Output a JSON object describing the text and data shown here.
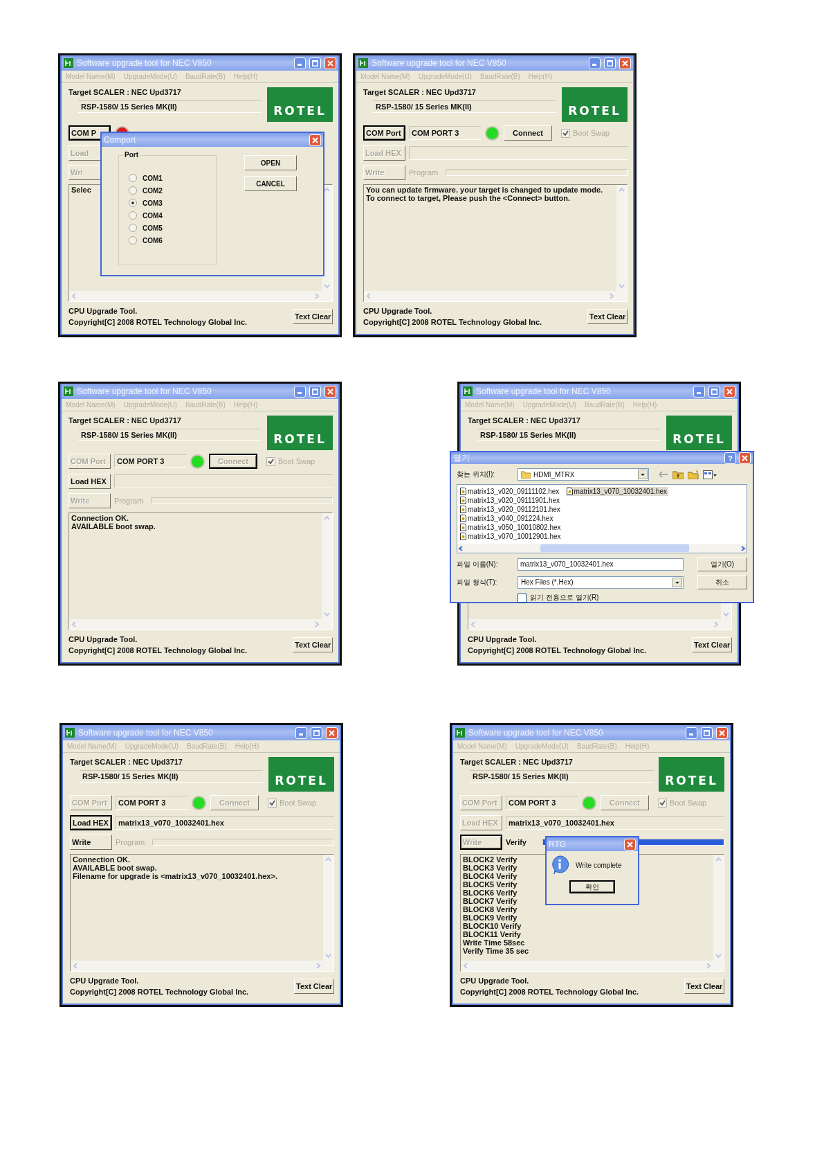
{
  "windows": [
    {
      "title": "Software upgrade tool for NEC V850",
      "menu": [
        "Model Name(M)",
        "UpgradeMode(U)",
        "BaudRate(B)",
        "Help(H)"
      ],
      "target": "Target SCALER : NEC Upd3717",
      "model": "RSP-1580/ 15 Series MK(II)",
      "logo": "ROTEL",
      "com_port": {
        "label": "COM P",
        "disabled": false,
        "focused": true
      },
      "led": {
        "color": "#e01818"
      },
      "load_hex": {
        "label": "Load",
        "disabled": true,
        "focused": false
      },
      "write": {
        "label": "Wri",
        "disabled": true,
        "focused": false
      },
      "log": [
        "Selec"
      ],
      "footer": [
        "CPU Upgrade Tool.",
        "Copyright[C] 2008 ROTEL Technology Global Inc."
      ],
      "text_clear": {
        "label": "Text Clear",
        "disabled": false,
        "focused": false
      },
      "dialog": {
        "kind": "comport",
        "title": "Comport",
        "group": "Port",
        "options": [
          {
            "label": "COM1",
            "selected": false
          },
          {
            "label": "COM2",
            "selected": false
          },
          {
            "label": "COM3",
            "selected": true
          },
          {
            "label": "COM4",
            "selected": false
          },
          {
            "label": "COM5",
            "selected": false
          },
          {
            "label": "COM6",
            "selected": false
          }
        ],
        "buttons": [
          "OPEN",
          "CANCEL"
        ]
      }
    },
    {
      "title": "Software upgrade tool for NEC V850",
      "menu": [
        "Model Name(M)",
        "UpgradeMode(U)",
        "BaudRate(B)",
        "Help(H)"
      ],
      "target": "Target SCALER : NEC Upd3717",
      "model": "RSP-1580/ 15 Series MK(II)",
      "logo": "ROTEL",
      "com_port": {
        "label": "COM Port",
        "disabled": false,
        "focused": true
      },
      "port": "COM PORT 3",
      "led": {
        "color": "#22dd22"
      },
      "connect": {
        "label": "Connect",
        "disabled": false,
        "focused": false
      },
      "boot_swap": {
        "label": "Boot Swap",
        "checked": true,
        "disabled": true
      },
      "load_hex": {
        "label": "Load HEX",
        "disabled": true,
        "focused": false
      },
      "write": {
        "label": "Write",
        "disabled": true,
        "focused": false
      },
      "progress": {
        "label": "Program",
        "disabled": true,
        "level": 0
      },
      "log": [
        "You can update firmware. your target is changed to update mode.",
        "To connect to target, Please push the <Connect> button."
      ],
      "footer": [
        "CPU Upgrade Tool.",
        "Copyright[C] 2008 ROTEL Technology Global Inc."
      ],
      "text_clear": {
        "label": "Text Clear",
        "disabled": false,
        "focused": false
      }
    },
    {
      "title": "Software upgrade tool for NEC V850",
      "menu": [
        "Model Name(M)",
        "UpgradeMode(U)",
        "BaudRate(B)",
        "Help(H)"
      ],
      "target": "Target SCALER : NEC Upd3717",
      "model": "RSP-1580/ 15 Series MK(II)",
      "logo": "ROTEL",
      "com_port": {
        "label": "COM Port",
        "disabled": true,
        "focused": false
      },
      "port": "COM PORT 3",
      "led": {
        "color": "#22dd22"
      },
      "connect": {
        "label": "Connect",
        "disabled": true,
        "focused": true
      },
      "boot_swap": {
        "label": "Boot Swap",
        "checked": true,
        "disabled": true
      },
      "load_hex": {
        "label": "Load HEX",
        "disabled": false,
        "focused": false
      },
      "write": {
        "label": "Write",
        "disabled": true,
        "focused": false
      },
      "progress": {
        "label": "Program",
        "disabled": true,
        "level": 0
      },
      "log": [
        "Connection OK.",
        "AVAILABLE boot swap."
      ],
      "footer": [
        "CPU Upgrade Tool.",
        "Copyright[C] 2008 ROTEL Technology Global Inc."
      ],
      "text_clear": {
        "label": "Text Clear",
        "disabled": false,
        "focused": false
      }
    },
    {
      "title": "Software upgrade tool for NEC V850",
      "menu": [
        "Model Name(M)",
        "UpgradeMode(U)",
        "BaudRate(B)",
        "Help(H)"
      ],
      "target": "Target SCALER : NEC Upd3717",
      "model": "RSP-1580/ 15 Series MK(II)",
      "logo": "ROTEL",
      "footer": [
        "CPU Upgrade Tool.",
        "Copyright[C] 2008 ROTEL Technology Global Inc."
      ],
      "text_clear": {
        "label": "Text Clear",
        "disabled": false,
        "focused": false
      },
      "dialog": {
        "kind": "open_file",
        "title": "열기",
        "help": "?",
        "location_label": "찾는 위치(I):",
        "location": "HDMI_MTRX",
        "files": [
          {
            "name": "matrix13_v020_09111102.hex",
            "selected": false
          },
          {
            "name": "matrix13_v020_09111901.hex",
            "selected": false
          },
          {
            "name": "matrix13_v020_09112101.hex",
            "selected": false
          },
          {
            "name": "matrix13_v040_091224.hex",
            "selected": false
          },
          {
            "name": "matrix13_v050_10010802.hex",
            "selected": false
          },
          {
            "name": "matrix13_v070_10012901.hex",
            "selected": false
          },
          {
            "name": "matrix13_v070_10032401.hex",
            "selected": true
          }
        ],
        "filename_label": "파일 이름(N):",
        "filename": "matrix13_v070_10032401.hex",
        "filetype_label": "파일 형식(T):",
        "filetype": "Hex Files (*.Hex)",
        "buttons": [
          "열기(O)",
          "취소"
        ],
        "readonly": {
          "label": "읽기 전용으로 열기(R)",
          "checked": false
        }
      }
    },
    {
      "title": "Software upgrade tool for NEC V850",
      "menu": [
        "Model Name(M)",
        "UpgradeMode(U)",
        "BaudRate(B)",
        "Help(H)"
      ],
      "target": "Target SCALER : NEC Upd3717",
      "model": "RSP-1580/ 15 Series MK(II)",
      "logo": "ROTEL",
      "com_port": {
        "label": "COM Port",
        "disabled": true,
        "focused": false
      },
      "port": "COM PORT 3",
      "led": {
        "color": "#22dd22"
      },
      "connect": {
        "label": "Connect",
        "disabled": true,
        "focused": false
      },
      "boot_swap": {
        "label": "Boot Swap",
        "checked": true,
        "disabled": true
      },
      "load_hex": {
        "label": "Load HEX",
        "disabled": false,
        "focused": true
      },
      "file": "matrix13_v070_10032401.hex",
      "write": {
        "label": "Write",
        "disabled": false,
        "focused": false
      },
      "progress": {
        "label": "Program",
        "disabled": true,
        "level": 0
      },
      "log": [
        "Connection OK.",
        "AVAILABLE boot swap.",
        "Filename for upgrade is <matrix13_v070_10032401.hex>."
      ],
      "footer": [
        "CPU Upgrade Tool.",
        "Copyright[C] 2008 ROTEL Technology Global Inc."
      ],
      "text_clear": {
        "label": "Text Clear",
        "disabled": false,
        "focused": false
      }
    },
    {
      "title": "Software upgrade tool for NEC V850",
      "menu": [
        "Model Name(M)",
        "UpgradeMode(U)",
        "BaudRate(B)",
        "Help(H)"
      ],
      "target": "Target SCALER : NEC Upd3717",
      "model": "RSP-1580/ 15 Series MK(II)",
      "logo": "ROTEL",
      "com_port": {
        "label": "COM Port",
        "disabled": true,
        "focused": false
      },
      "port": "COM PORT 3",
      "led": {
        "color": "#22dd22"
      },
      "connect": {
        "label": "Connect",
        "disabled": true,
        "focused": false
      },
      "boot_swap": {
        "label": "Boot Swap",
        "checked": true,
        "disabled": true
      },
      "load_hex": {
        "label": "Load HEX",
        "disabled": true,
        "focused": false
      },
      "file": "matrix13_v070_10032401.hex",
      "write": {
        "label": "Write",
        "disabled": true,
        "focused": true
      },
      "progress": {
        "label": "Verify",
        "disabled": false,
        "level": 1
      },
      "log": [
        "BLOCK2 Verify",
        "BLOCK3 Verify",
        "BLOCK4 Verify",
        "BLOCK5 Verify",
        "BLOCK6 Verify",
        "BLOCK7 Verify",
        "BLOCK8 Verify",
        "BLOCK9 Verify",
        "BLOCK10 Verify",
        "BLOCK11 Verify",
        "Write Time 58sec",
        "Verify Time 35 sec"
      ],
      "footer": [
        "CPU Upgrade Tool.",
        "Copyright[C] 2008 ROTEL Technology Global Inc."
      ],
      "text_clear": {
        "label": "Text Clear",
        "disabled": false,
        "focused": false
      },
      "dialog": {
        "kind": "message",
        "title": "RTG",
        "text": "Write complete",
        "buttons": [
          "확인"
        ]
      }
    }
  ]
}
